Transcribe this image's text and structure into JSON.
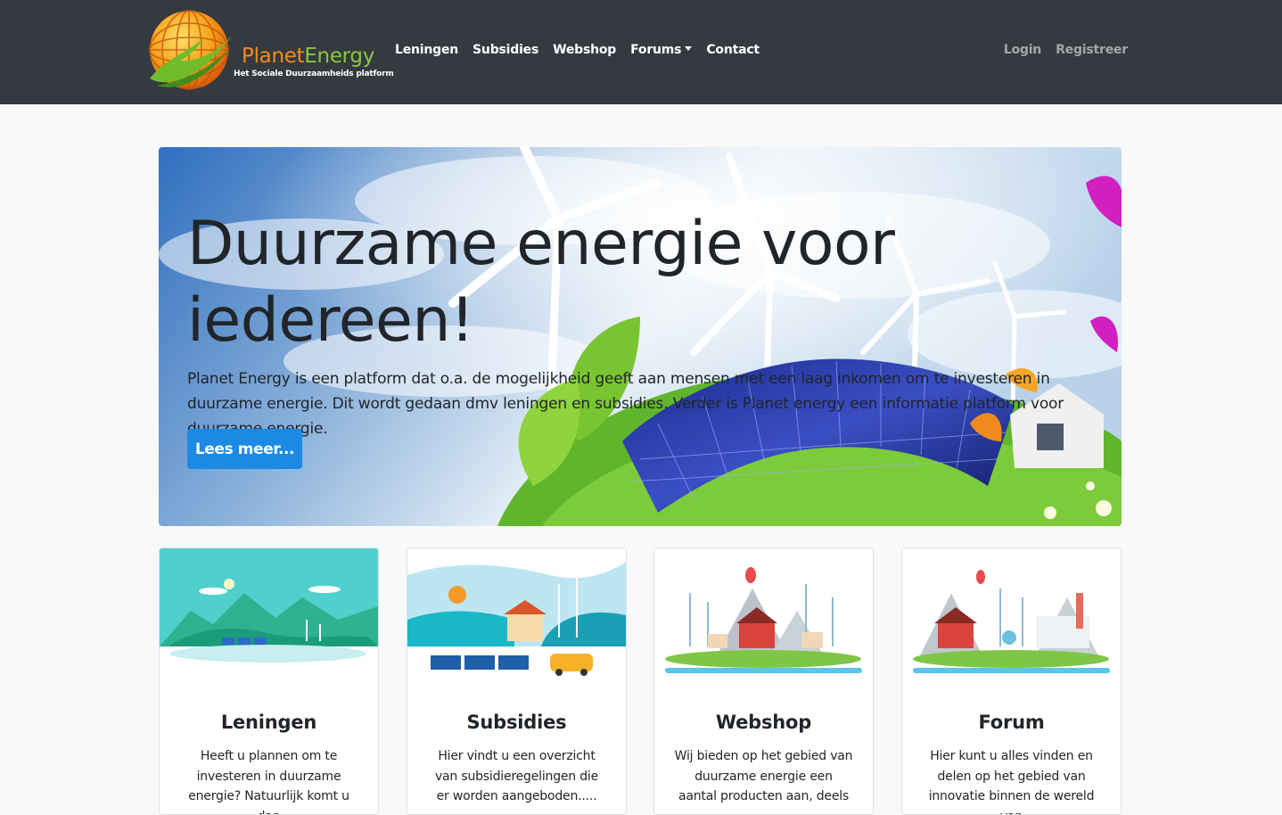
{
  "brand": {
    "name_planet": "Planet",
    "name_energy": "Energy",
    "tagline": "Het Sociale Duurzaamheids platform"
  },
  "nav": {
    "items": [
      {
        "label": "Leningen"
      },
      {
        "label": "Subsidies"
      },
      {
        "label": "Webshop"
      },
      {
        "label": "Forums"
      },
      {
        "label": "Contact"
      }
    ],
    "login": "Login",
    "register": "Registreer"
  },
  "hero": {
    "title": "Duurzame energie voor iedereen!",
    "text": "Planet Energy is een platform dat o.a. de mogelijkheid geeft aan mensen met een laag inkomen om te investeren in duurzame energie. Dit wordt gedaan dmv leningen en subsidies. Verder is Planet energy een informatie platform voor duurzame energie.",
    "button": "Lees meer..."
  },
  "cards": [
    {
      "title": "Leningen",
      "text": "Heeft u plannen om te investeren in duurzame energie? Natuurlijk komt u dan"
    },
    {
      "title": "Subsidies",
      "text": "Hier vindt u een overzicht van subsidieregelingen die er worden aangeboden....."
    },
    {
      "title": "Webshop",
      "text": "Wij bieden op het gebied van duurzame energie een aantal producten aan, deels"
    },
    {
      "title": "Forum",
      "text": "Hier kunt u alles vinden en delen op het gebied van innovatie binnen de wereld van"
    }
  ],
  "colors": {
    "navbar": "#343a40",
    "brand_orange": "#f48a1c",
    "brand_green": "#8cc640",
    "primary_button": "#1b8ae3",
    "page_background": "#f8f9fb"
  }
}
